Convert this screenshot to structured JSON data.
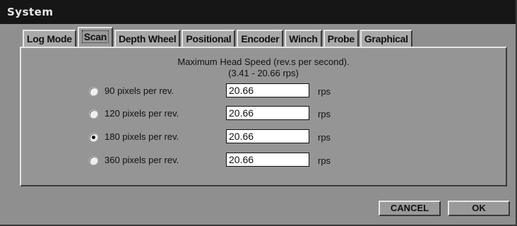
{
  "window": {
    "title": "System"
  },
  "tabs": [
    {
      "label": "Log Mode",
      "active": false
    },
    {
      "label": "Scan",
      "active": true
    },
    {
      "label": "Depth Wheel",
      "active": false
    },
    {
      "label": "Positional",
      "active": false
    },
    {
      "label": "Encoder",
      "active": false
    },
    {
      "label": "Winch",
      "active": false
    },
    {
      "label": "Probe",
      "active": false
    },
    {
      "label": "Graphical",
      "active": false
    }
  ],
  "scan": {
    "heading_line1": "Maximum Head Speed (rev.s per second).",
    "heading_line2": "(3.41 - 20.66 rps)",
    "options": [
      {
        "label": "90 pixels per rev.",
        "value": "20.66",
        "unit": "rps",
        "selected": false
      },
      {
        "label": "120 pixels per rev.",
        "value": "20.66",
        "unit": "rps",
        "selected": false
      },
      {
        "label": "180 pixels per rev.",
        "value": "20.66",
        "unit": "rps",
        "selected": true
      },
      {
        "label": "360 pixels per rev.",
        "value": "20.66",
        "unit": "rps",
        "selected": false
      }
    ]
  },
  "buttons": {
    "cancel": "CANCEL",
    "ok": "OK"
  }
}
